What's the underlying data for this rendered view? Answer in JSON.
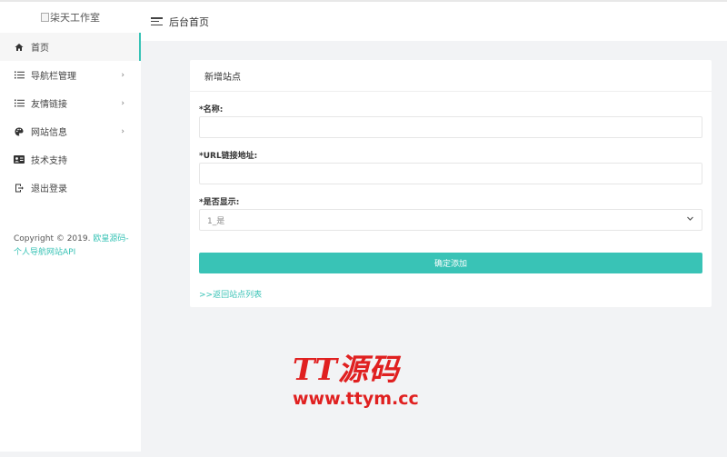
{
  "sidebar": {
    "logo_alt": "柒天工作室",
    "items": [
      {
        "label": "首页",
        "icon": "home-icon",
        "active": true
      },
      {
        "label": "导航栏管理",
        "icon": "list-icon",
        "caret": "›"
      },
      {
        "label": "友情链接",
        "icon": "list-icon",
        "caret": "›"
      },
      {
        "label": "网站信息",
        "icon": "palette-icon",
        "caret": "›"
      },
      {
        "label": "技术支持",
        "icon": "id-card-icon"
      },
      {
        "label": "退出登录",
        "icon": "logout-icon"
      }
    ],
    "copyright_prefix": "Copyright © 2019. ",
    "copyright_link": "欧皇源码-个人导航网站API"
  },
  "topbar": {
    "title": "后台首页",
    "menu_icon": "hamburger-icon"
  },
  "card": {
    "title": "新增站点",
    "name_label": "*名称:",
    "name_value": "",
    "url_label": "*URL链接地址:",
    "url_value": "",
    "show_label": "*是否显示:",
    "show_selected": "1_是",
    "submit_label": "确定添加",
    "back_link": ">>返回站点列表"
  },
  "watermark": {
    "line1": "TT源码",
    "line2": "www.ttym.cc"
  },
  "colors": {
    "accent": "#39c3b6",
    "watermark": "#e02020"
  }
}
